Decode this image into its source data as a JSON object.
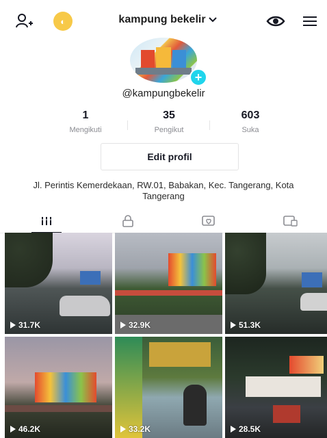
{
  "header": {
    "username": "kampung bekelir",
    "coin_label": "◐"
  },
  "profile": {
    "handle": "@kampungbekelir",
    "avatar_badge": "+",
    "stats": [
      {
        "value": "1",
        "label": "Mengikuti"
      },
      {
        "value": "35",
        "label": "Pengikut"
      },
      {
        "value": "603",
        "label": "Suka"
      }
    ],
    "edit_button": "Edit profil",
    "bio": "Jl. Perintis Kemerdekaan, RW.01, Babakan, Kec. Tangerang, Kota Tangerang"
  },
  "tabs": [
    "videos",
    "private",
    "liked",
    "favorites"
  ],
  "videos": [
    {
      "views": "31.7K"
    },
    {
      "views": "32.9K"
    },
    {
      "views": "51.3K"
    },
    {
      "views": "46.2K"
    },
    {
      "views": "33.2K"
    },
    {
      "views": "28.5K"
    }
  ],
  "colors": {
    "accent": "#20d5ec",
    "text": "#161823",
    "muted": "#8a8b91",
    "coin": "#f7c948"
  }
}
